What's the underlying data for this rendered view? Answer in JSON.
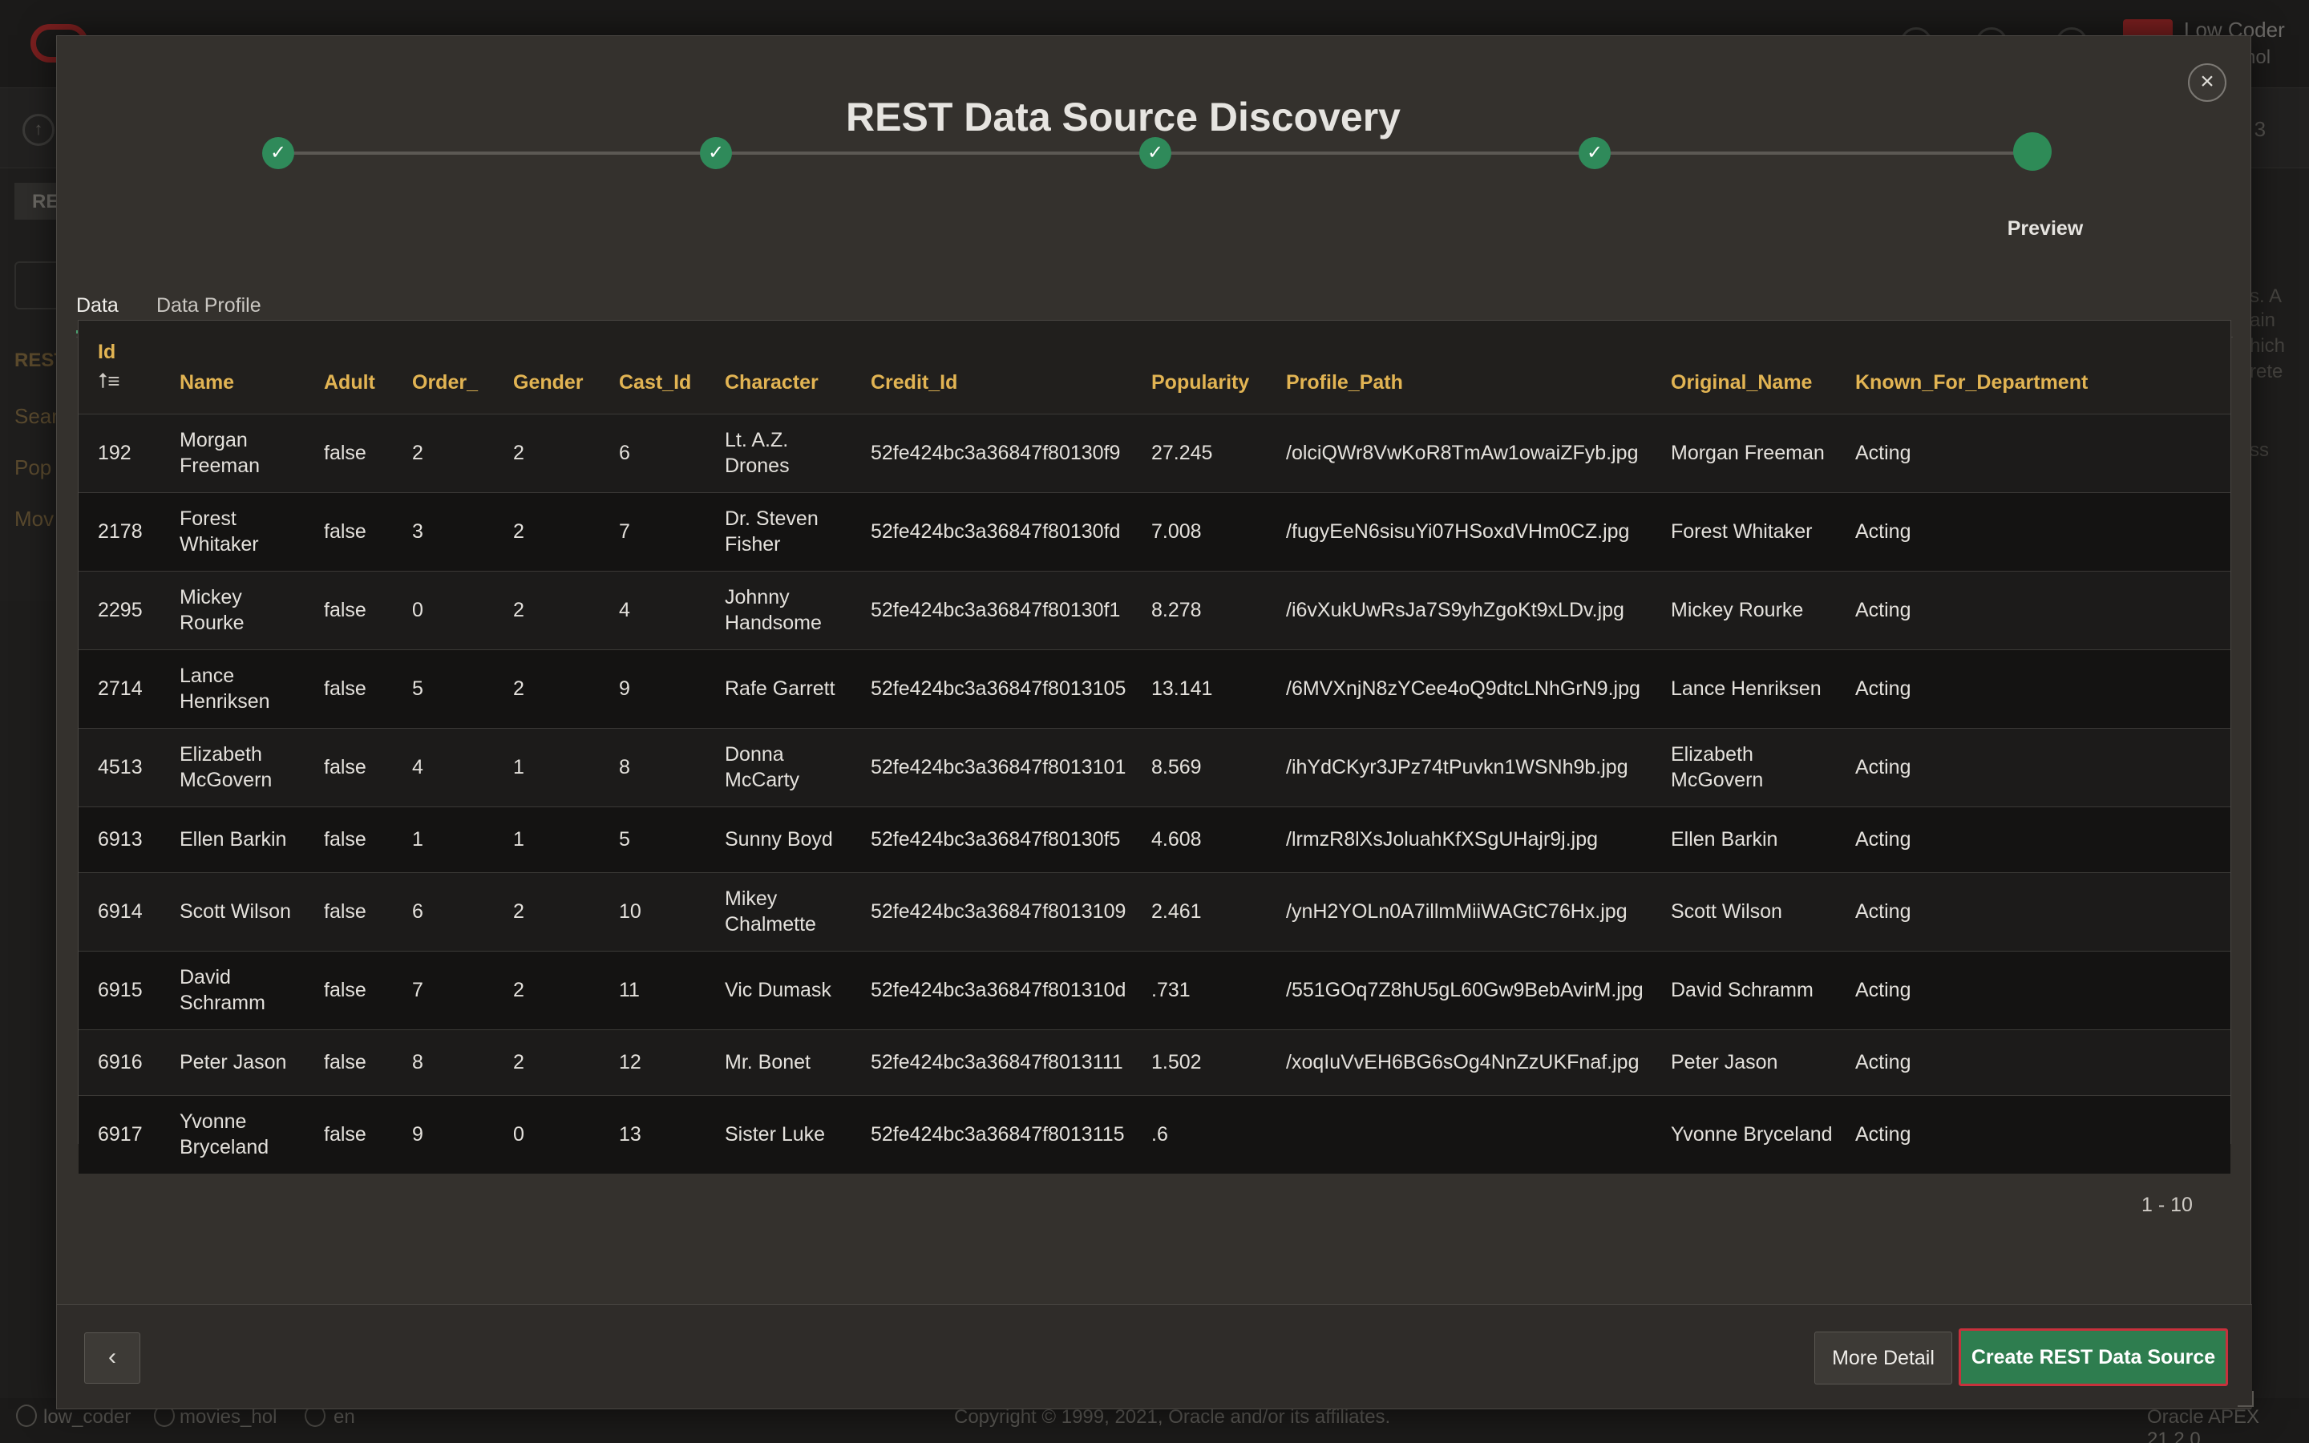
{
  "background": {
    "user_name": "Low Coder",
    "user_schema": "hol",
    "page_label": "e 3",
    "rest_chip": "RE",
    "rest_label": "REST",
    "side_items": [
      "Sear",
      "Pop",
      "Mov"
    ],
    "right_text": [
      "s. A",
      "ain",
      "hich",
      "rete",
      "ss"
    ],
    "footer": {
      "user": "low_coder",
      "schema": "movies_hol",
      "lang": "en",
      "copyright": "Copyright © 1999, 2021, Oracle and/or its affiliates.",
      "version": "Oracle APEX 21.2.0"
    }
  },
  "modal": {
    "title": "REST Data Source Discovery",
    "close_icon": "×",
    "wizard": {
      "steps": [
        "✓",
        "✓",
        "✓",
        "✓",
        ""
      ],
      "current_label": "Preview"
    },
    "tabs": [
      "Data",
      "Data Profile"
    ],
    "table": {
      "columns": [
        "Id",
        "Name",
        "Adult",
        "Order_",
        "Gender",
        "Cast_Id",
        "Character",
        "Credit_Id",
        "Popularity",
        "Profile_Path",
        "Original_Name",
        "Known_For_Department"
      ],
      "sort_icon": "⭡≡",
      "rows": [
        [
          "192",
          "Morgan Freeman",
          "false",
          "2",
          "2",
          "6",
          "Lt. A.Z. Drones",
          "52fe424bc3a36847f80130f9",
          "27.245",
          "/olciQWr8VwKoR8TmAw1owaiZFyb.jpg",
          "Morgan Freeman",
          "Acting"
        ],
        [
          "2178",
          "Forest Whitaker",
          "false",
          "3",
          "2",
          "7",
          "Dr. Steven Fisher",
          "52fe424bc3a36847f80130fd",
          "7.008",
          "/fugyEeN6sisuYi07HSoxdVHm0CZ.jpg",
          "Forest Whitaker",
          "Acting"
        ],
        [
          "2295",
          "Mickey Rourke",
          "false",
          "0",
          "2",
          "4",
          "Johnny Handsome",
          "52fe424bc3a36847f80130f1",
          "8.278",
          "/i6vXukUwRsJa7S9yhZgoKt9xLDv.jpg",
          "Mickey Rourke",
          "Acting"
        ],
        [
          "2714",
          "Lance Henriksen",
          "false",
          "5",
          "2",
          "9",
          "Rafe Garrett",
          "52fe424bc3a36847f8013105",
          "13.141",
          "/6MVXnjN8zYCee4oQ9dtcLNhGrN9.jpg",
          "Lance Henriksen",
          "Acting"
        ],
        [
          "4513",
          "Elizabeth McGovern",
          "false",
          "4",
          "1",
          "8",
          "Donna McCarty",
          "52fe424bc3a36847f8013101",
          "8.569",
          "/ihYdCKyr3JPz74tPuvkn1WSNh9b.jpg",
          "Elizabeth McGovern",
          "Acting"
        ],
        [
          "6913",
          "Ellen Barkin",
          "false",
          "1",
          "1",
          "5",
          "Sunny Boyd",
          "52fe424bc3a36847f80130f5",
          "4.608",
          "/lrmzR8lXsJoluahKfXSgUHajr9j.jpg",
          "Ellen Barkin",
          "Acting"
        ],
        [
          "6914",
          "Scott Wilson",
          "false",
          "6",
          "2",
          "10",
          "Mikey Chalmette",
          "52fe424bc3a36847f8013109",
          "2.461",
          "/ynH2YOLn0A7illmMiiWAGtC76Hx.jpg",
          "Scott Wilson",
          "Acting"
        ],
        [
          "6915",
          "David Schramm",
          "false",
          "7",
          "2",
          "11",
          "Vic Dumask",
          "52fe424bc3a36847f801310d",
          ".731",
          "/551GOq7Z8hU5gL60Gw9BebAvirM.jpg",
          "David Schramm",
          "Acting"
        ],
        [
          "6916",
          "Peter Jason",
          "false",
          "8",
          "2",
          "12",
          "Mr. Bonet",
          "52fe424bc3a36847f8013111",
          "1.502",
          "/xoqIuVvEH6BG6sOg4NnZzUKFnaf.jpg",
          "Peter Jason",
          "Acting"
        ],
        [
          "6917",
          "Yvonne Bryceland",
          "false",
          "9",
          "0",
          "13",
          "Sister Luke",
          "52fe424bc3a36847f8013115",
          ".6",
          "",
          "Yvonne Bryceland",
          "Acting"
        ]
      ]
    },
    "pagination": "1 - 10",
    "buttons": {
      "back_icon": "‹",
      "more_detail": "More Detail",
      "create": "Create REST Data Source"
    }
  }
}
